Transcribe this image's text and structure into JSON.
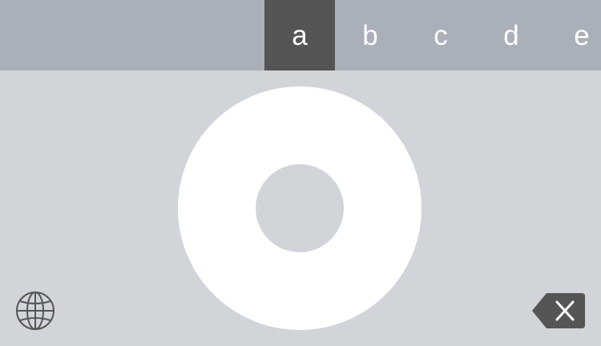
{
  "keyboard": {
    "letters": [
      "a",
      "b",
      "c",
      "d",
      "e"
    ],
    "selected_letter": "a",
    "icons": {
      "globe": "globe-icon",
      "backspace": "backspace-icon"
    },
    "colors": {
      "strip_background": "#aab0b9",
      "selected_key": "#555555",
      "keyboard_background": "#d1d5da",
      "wheel": "#ffffff",
      "icon": "#555555"
    }
  }
}
